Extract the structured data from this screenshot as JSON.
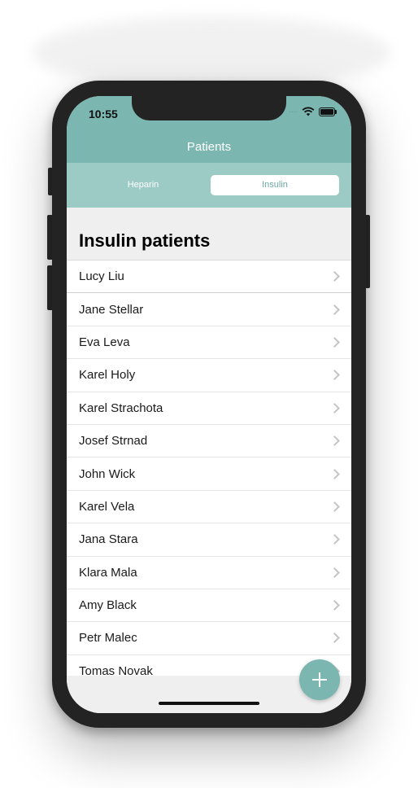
{
  "status_bar": {
    "time": "10:55",
    "signal": "····",
    "wifi_icon": "wifi-icon",
    "battery_icon": "battery-icon"
  },
  "nav": {
    "title": "Patients"
  },
  "segments": {
    "options": [
      "Heparin",
      "Insulin"
    ],
    "selected": "Insulin"
  },
  "section": {
    "title": "Insulin patients"
  },
  "patients": [
    "Lucy Liu",
    "Jane Stellar",
    "Eva Leva",
    "Karel Holy",
    "Karel Strachota",
    "Josef Strnad",
    "John Wick",
    "Karel Vela",
    "Jana Stara",
    "Klara Mala",
    "Amy Black",
    "Petr Malec",
    "Tomas Novak"
  ],
  "fab": {
    "icon": "plus-icon"
  },
  "colors": {
    "accent": "#7bb6b0",
    "segment_bg": "#9ccbc6",
    "selected_text": "#6aa9a3"
  }
}
